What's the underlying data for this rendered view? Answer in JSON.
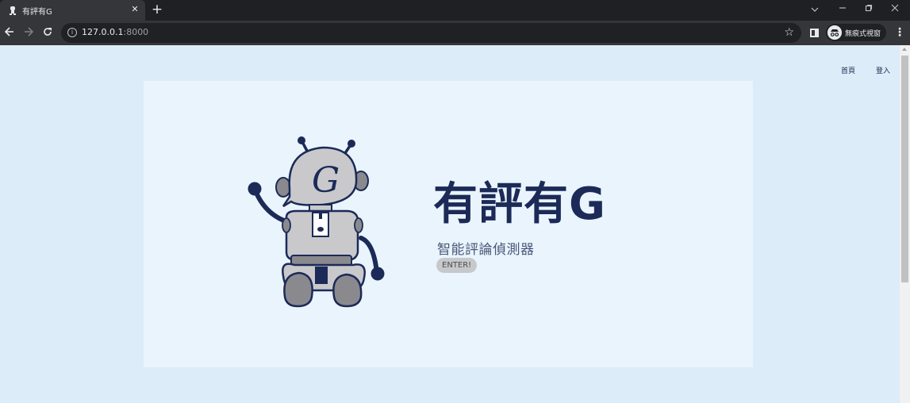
{
  "browser": {
    "tab_title": "有評有G",
    "tab_close": "✕",
    "new_tab": "+",
    "url_host": "127.0.0.1",
    "url_port": ":8000",
    "incognito_label": "無痕式視窗",
    "icons": [
      "robot-favicon-icon",
      "back-arrow-icon",
      "forward-arrow-icon",
      "reload-icon",
      "info-icon",
      "star-icon",
      "side-panel-icon",
      "incognito-icon",
      "more-menu-icon",
      "tab-search-icon",
      "minimize-icon",
      "restore-icon",
      "window-close-icon"
    ]
  },
  "nav": {
    "home": "首頁",
    "login": "登入"
  },
  "hero": {
    "title": "有評有G",
    "subtitle": "智能評論偵測器",
    "enter_label": "ENTER!",
    "robot_letter": "G"
  },
  "colors": {
    "page_bg": "#dcecf8",
    "hero_bg": "#eaf4fd",
    "title": "#1c2a57",
    "robot_body": "#c9c9cc",
    "robot_dark": "#1c2a57",
    "button_bg": "#c7c8cb"
  }
}
